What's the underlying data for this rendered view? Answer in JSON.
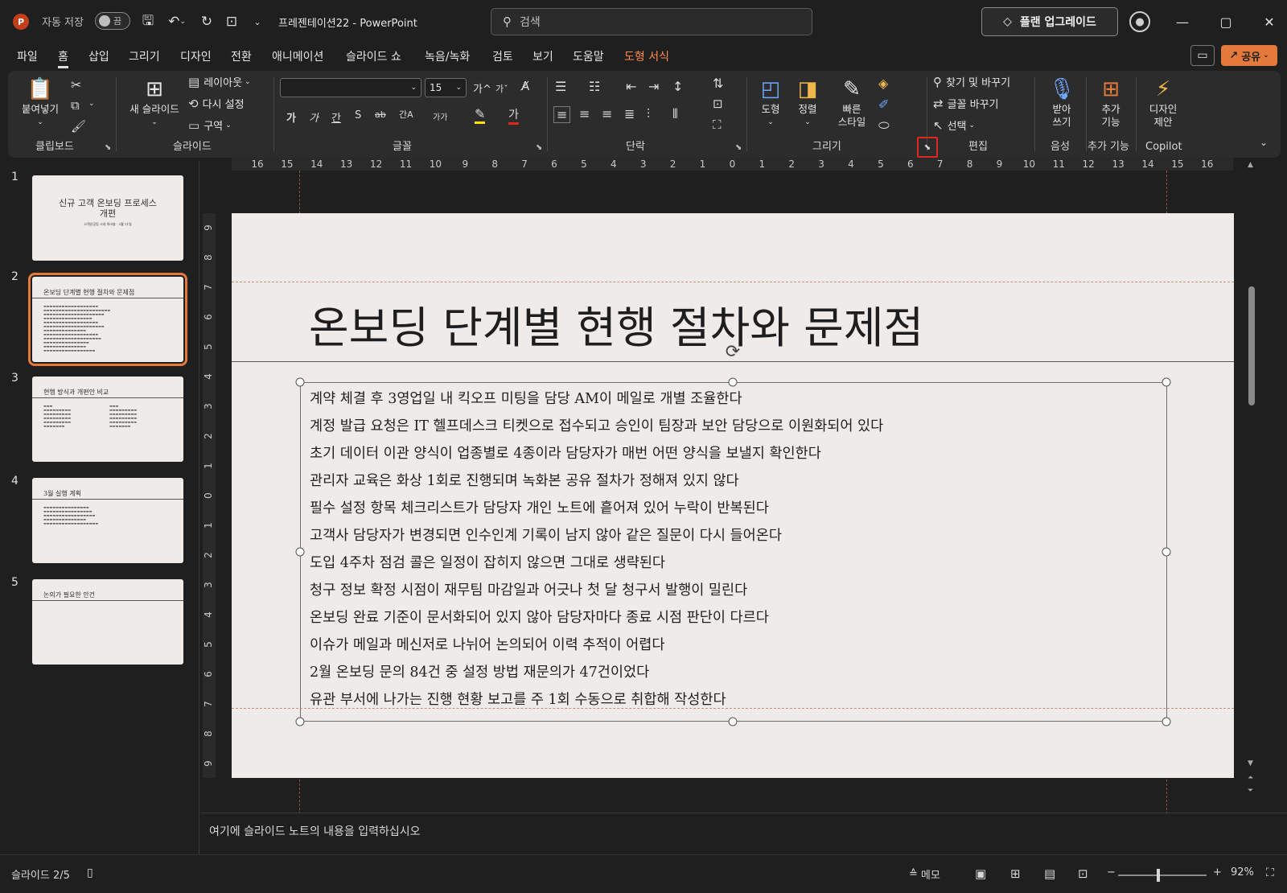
{
  "titlebar": {
    "autosave_label": "자동 저장",
    "autosave_state": "끔",
    "doc_title": "프레젠테이션22  -  PowerPoint",
    "search_placeholder": "검색",
    "upgrade_label": "플랜 업그레이드",
    "icons": [
      "save-icon",
      "undo-icon",
      "redo-icon",
      "present-icon",
      "customize-icon"
    ]
  },
  "menu": {
    "tabs": [
      "파일",
      "홈",
      "삽입",
      "그리기",
      "디자인",
      "전환",
      "애니메이션",
      "슬라이드 쇼",
      "녹음/녹화",
      "검토",
      "보기",
      "도움말",
      "도형 서식"
    ],
    "active": "홈",
    "share_label": "공유"
  },
  "ribbon": {
    "clipboard": {
      "label": "클립보드",
      "paste": "붙여넣기"
    },
    "slides": {
      "label": "슬라이드",
      "new_slide": "새 슬라이드",
      "layout": "레이아웃",
      "reset": "다시 설정",
      "section": "구역"
    },
    "font": {
      "label": "글꼴",
      "font_name": "",
      "font_size": "15",
      "b": "가",
      "i": "가",
      "u": "간",
      "s": "S",
      "strike": "ab",
      "spacing": "간A",
      "case": "가가",
      "grow": "가",
      "shrink": "가",
      "color": "가"
    },
    "paragraph": {
      "label": "단락"
    },
    "drawing": {
      "label": "그리기",
      "shapes": "도형",
      "arrange": "정렬",
      "quick_style_1": "빠른",
      "quick_style_2": "스타일"
    },
    "editing": {
      "label": "편집",
      "find_replace": "찾기 및 바꾸기",
      "replace_font": "글꼴 바꾸기",
      "select": "선택"
    },
    "voice": {
      "label": "음성",
      "dictate_1": "받아",
      "dictate_2": "쓰기"
    },
    "addins": {
      "label": "추가 기능",
      "addins_1": "추가",
      "addins_2": "기능"
    },
    "copilot": {
      "label": "Copilot",
      "designer_1": "디자인",
      "designer_2": "제안"
    }
  },
  "thumbnails": [
    {
      "num": "1",
      "title": "신규 고객 온보딩 프로세스 개편",
      "subtitle": "고객성공팀 시내 워크숍 · 3월 11일"
    },
    {
      "num": "2",
      "title": "온보딩 단계별 현행 절차와 문제점",
      "selected": true
    },
    {
      "num": "3",
      "title": "현행 방식과 개편안 비교"
    },
    {
      "num": "4",
      "title": "3월 실행 계획"
    },
    {
      "num": "5",
      "title": "논의가 필요한 안건"
    }
  ],
  "slide": {
    "title": "온보딩 단계별 현행 절차와 문제점",
    "bullets": [
      "계약 체결 후 3영업일 내 킥오프 미팅을 담당 AM이 메일로 개별 조율한다",
      "계정 발급 요청은 IT 헬프데스크 티켓으로 접수되고 승인이 팀장과 보안 담당으로 이원화되어 있다",
      "초기 데이터 이관 양식이 업종별로 4종이라 담당자가 매번 어떤 양식을 보낼지 확인한다",
      "관리자 교육은 화상 1회로 진행되며 녹화본 공유 절차가 정해져 있지 않다",
      "필수 설정 항목 체크리스트가 담당자 개인 노트에 흩어져 있어 누락이 반복된다",
      "고객사 담당자가 변경되면 인수인계 기록이 남지 않아 같은 질문이 다시 들어온다",
      "도입 4주차 점검 콜은 일정이 잡히지 않으면 그대로 생략된다",
      "청구 정보 확정 시점이 재무팀 마감일과 어긋나 첫 달 청구서 발행이 밀린다",
      "온보딩 완료 기준이 문서화되어 있지 않아 담당자마다 종료 시점 판단이 다르다",
      "이슈가 메일과 메신저로 나뉘어 논의되어 이력 추적이 어렵다",
      "2월 온보딩 문의 84건 중 설정 방법 재문의가 47건이었다",
      "유관 부서에 나가는 진행 현황 보고를 주 1회 수동으로 취합해 작성한다"
    ]
  },
  "ruler": {
    "h": [
      "16",
      "15",
      "14",
      "13",
      "12",
      "11",
      "10",
      "9",
      "8",
      "7",
      "6",
      "5",
      "4",
      "3",
      "2",
      "1",
      "0",
      "1",
      "2",
      "3",
      "4",
      "5",
      "6",
      "7",
      "8",
      "9",
      "10",
      "11",
      "12",
      "13",
      "14",
      "15",
      "16"
    ],
    "v": [
      "9",
      "8",
      "7",
      "6",
      "5",
      "4",
      "3",
      "2",
      "1",
      "0",
      "1",
      "2",
      "3",
      "4",
      "5",
      "6",
      "7",
      "8",
      "9"
    ]
  },
  "notes": {
    "placeholder": "여기에 슬라이드 노트의 내용을 입력하십시오"
  },
  "status": {
    "slide_pos": "슬라이드 2/5",
    "notes_btn": "메모",
    "zoom": "92%"
  }
}
